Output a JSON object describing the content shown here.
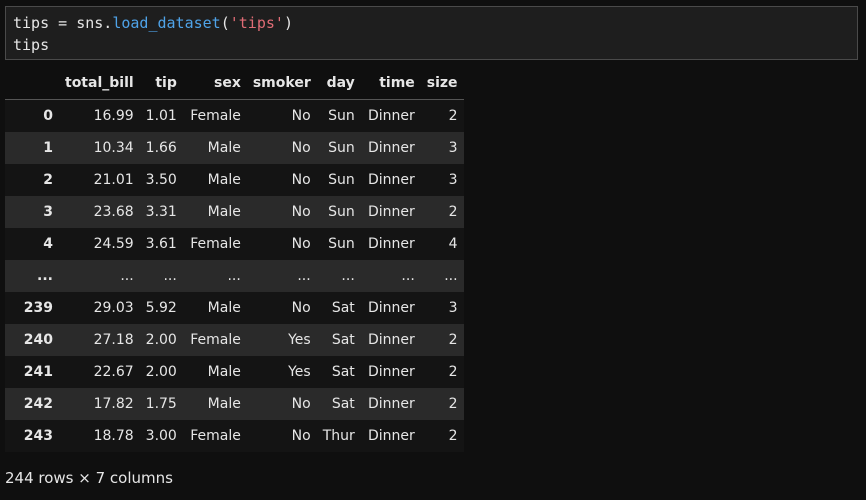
{
  "code_cell": {
    "line1": {
      "var": "tips",
      "op": " = ",
      "module": "sns.",
      "func": "load_dataset",
      "open": "(",
      "arg": "'tips'",
      "close": ")"
    },
    "line2": "tips"
  },
  "dataframe": {
    "columns": [
      "",
      "total_bill",
      "tip",
      "sex",
      "smoker",
      "day",
      "time",
      "size"
    ],
    "rows": [
      [
        "0",
        "16.99",
        "1.01",
        "Female",
        "No",
        "Sun",
        "Dinner",
        "2"
      ],
      [
        "1",
        "10.34",
        "1.66",
        "Male",
        "No",
        "Sun",
        "Dinner",
        "3"
      ],
      [
        "2",
        "21.01",
        "3.50",
        "Male",
        "No",
        "Sun",
        "Dinner",
        "3"
      ],
      [
        "3",
        "23.68",
        "3.31",
        "Male",
        "No",
        "Sun",
        "Dinner",
        "2"
      ],
      [
        "4",
        "24.59",
        "3.61",
        "Female",
        "No",
        "Sun",
        "Dinner",
        "4"
      ],
      [
        "...",
        "...",
        "...",
        "...",
        "...",
        "...",
        "...",
        "..."
      ],
      [
        "239",
        "29.03",
        "5.92",
        "Male",
        "No",
        "Sat",
        "Dinner",
        "3"
      ],
      [
        "240",
        "27.18",
        "2.00",
        "Female",
        "Yes",
        "Sat",
        "Dinner",
        "2"
      ],
      [
        "241",
        "22.67",
        "2.00",
        "Male",
        "Yes",
        "Sat",
        "Dinner",
        "2"
      ],
      [
        "242",
        "17.82",
        "1.75",
        "Male",
        "No",
        "Sat",
        "Dinner",
        "2"
      ],
      [
        "243",
        "18.78",
        "3.00",
        "Female",
        "No",
        "Thur",
        "Dinner",
        "2"
      ]
    ],
    "shape_text": "244 rows × 7 columns"
  },
  "colors": {
    "background": "#0f0f0f",
    "cell_background": "#1e1e1e",
    "function": "#4fa3e8",
    "string": "#e06c75",
    "text": "#e6e6e6"
  }
}
